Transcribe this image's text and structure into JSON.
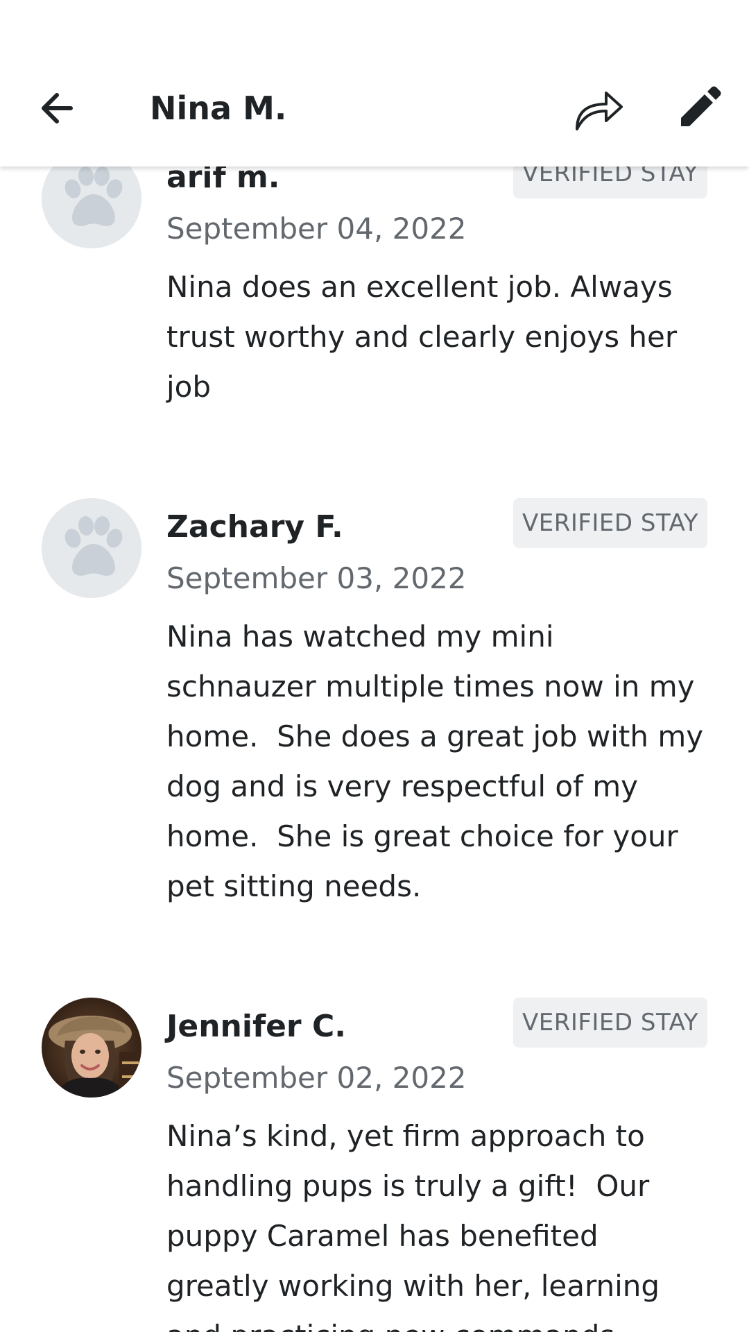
{
  "header": {
    "title": "Nina M.",
    "back_icon": "arrow-left-icon",
    "share_icon": "share-arrow-icon",
    "edit_icon": "pencil-icon"
  },
  "reviews": [
    {
      "name": "arif m.",
      "date": "September 04, 2022",
      "badge": "VERIFIED STAY",
      "avatar": "paw-icon",
      "text": "Nina does an excellent job. Always trust worthy and clearly enjoys her job"
    },
    {
      "name": "Zachary F.",
      "date": "September 03, 2022",
      "badge": "VERIFIED STAY",
      "avatar": "paw-icon",
      "text": "Nina has watched my mini schnauzer multiple times now in my home.  She does a great job with my dog and is very respectful of my home.  She is great choice for your pet sitting needs."
    },
    {
      "name": "Jennifer C.",
      "date": "September 02, 2022",
      "badge": "VERIFIED STAY",
      "avatar": "user-photo",
      "text": "Nina’s kind, yet firm approach to handling pups is truly a gift!  Our puppy Caramel has benefited greatly working with her, learning and practicing new commands"
    }
  ],
  "colors": {
    "text_primary": "#1f2326",
    "text_secondary": "#62686e",
    "badge_bg": "#eef0f2",
    "avatar_bg": "#e6e9ec",
    "paw": "#c9d0d7"
  }
}
